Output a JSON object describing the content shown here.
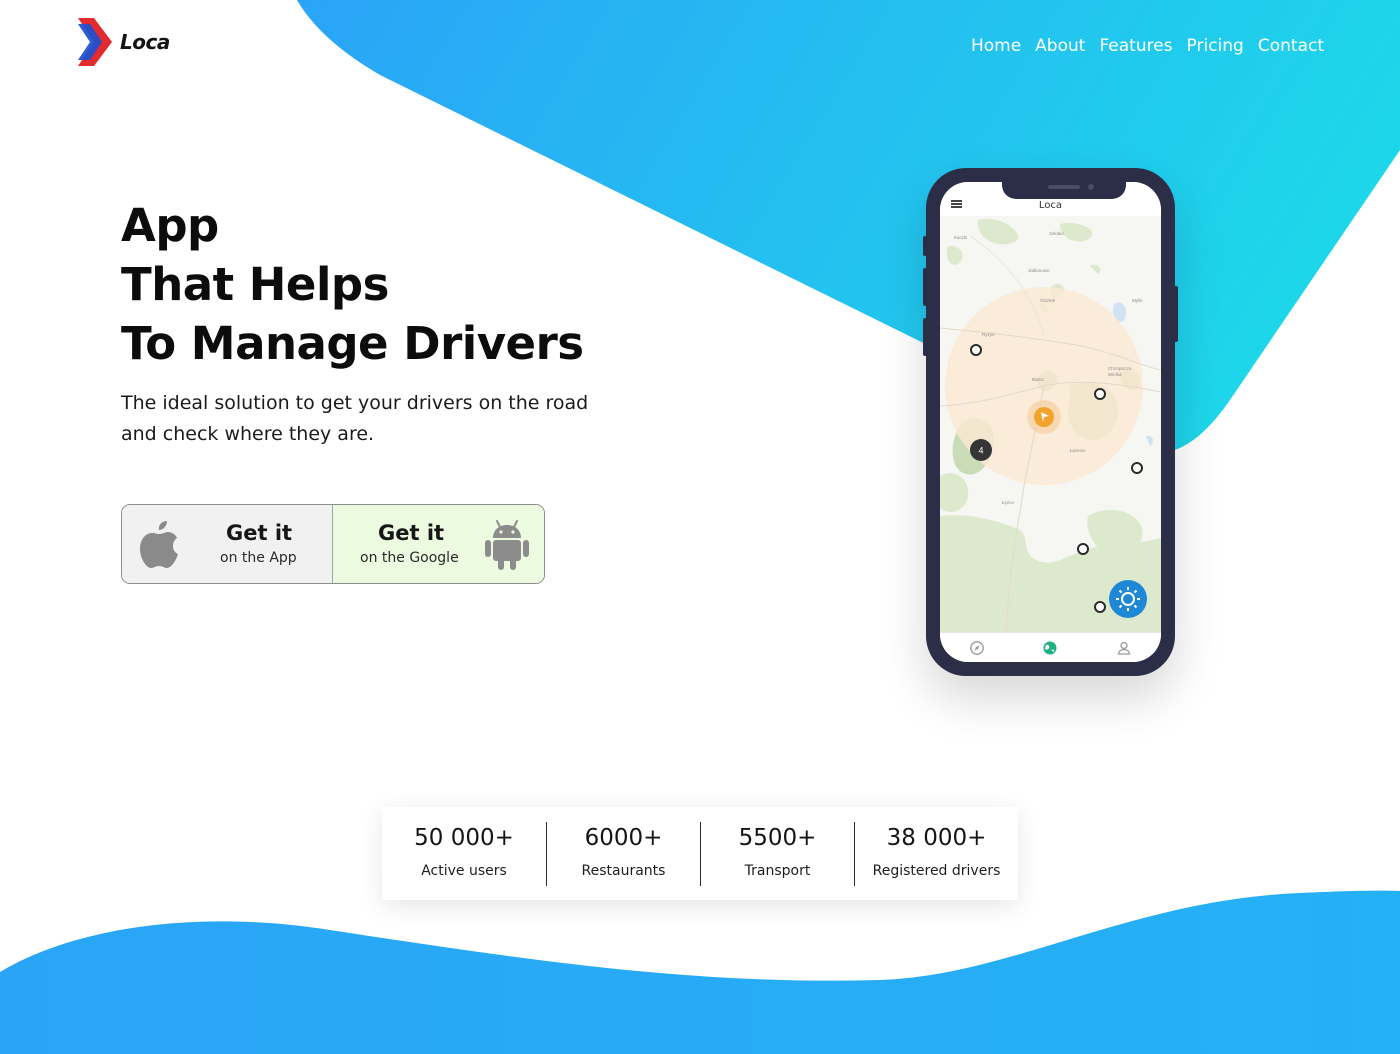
{
  "brand": {
    "name": "Loca"
  },
  "nav": {
    "items": [
      "Home",
      "About",
      "Features",
      "Pricing",
      "Contact"
    ]
  },
  "hero": {
    "title_lines": [
      "App",
      "That Helps",
      "To Manage Drivers"
    ],
    "subtitle": "The ideal solution to get your drivers on the road and check where they are."
  },
  "stores": {
    "apple": {
      "title": "Get it",
      "subtitle": "on the App",
      "icon": "apple-icon"
    },
    "google": {
      "title": "Get it",
      "subtitle": "on the Google",
      "icon": "android-icon"
    }
  },
  "phone": {
    "app_title": "Loca",
    "cluster_count": "4",
    "tabs": [
      "compass-icon",
      "map-icon",
      "profile-icon"
    ],
    "fab_icon": "gear-icon"
  },
  "stats": [
    {
      "value": "50 000+",
      "label": "Active users"
    },
    {
      "value": "6000+",
      "label": "Restaurants"
    },
    {
      "value": "5500+",
      "label": "Transport"
    },
    {
      "value": "38 000+",
      "label": "Registered drivers"
    }
  ],
  "colors": {
    "accent_blue": "#2aa8f5",
    "accent_cyan": "#1ed3ea",
    "phone_frame": "#2c2d46",
    "logo_red": "#e12b2f",
    "logo_blue": "#1b4fd0"
  }
}
